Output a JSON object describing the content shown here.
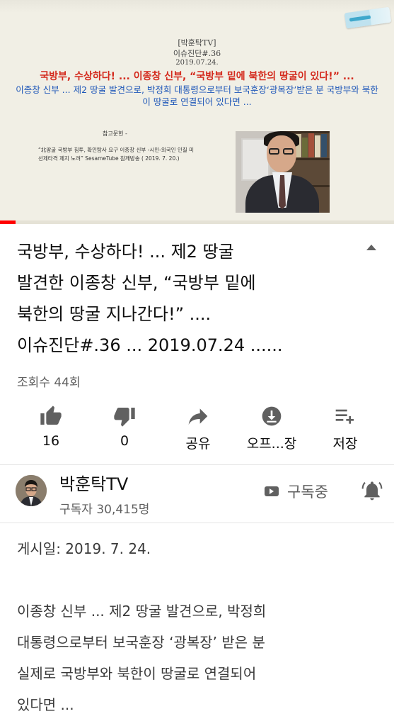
{
  "video": {
    "slide_channel": "[박훈탁TV]",
    "slide_series": "이슈진단#.36",
    "slide_date": "2019.07.24.",
    "slide_headline": "국방부, 수상하다! ... 이종창 신부, “국방부 밑에 북한의 땅굴이 있다!” ...",
    "slide_subtitle": "이종창 신부 ... 제2 땅굴 발견으로, 박정희 대통령으로부터 보국훈장‘광복장’받은 분 국방부와 북한이 땅굴로 연결되어 있다면 ...",
    "slide_reference_heading": "참고문헌 -",
    "slide_reference_body": "“北땅굴 국방부 침투, 확인탐사 요구 이종창 신부 -시민-외국인 인질 미 선제타격 제지 노려” SesameTube 참깨방송 ( 2019. 7. 20.)",
    "progress_percent": 4,
    "colors": {
      "progress": "#ff0000",
      "headline": "#d42b1e",
      "subtitle": "#1d56b8"
    }
  },
  "title": {
    "line1": "국방부, 수상하다! ... 제2 땅굴",
    "line2": "발견한 이종창 신부, “국방부 밑에",
    "line3": "북한의 땅굴 지나간다!” ....",
    "line4": "이슈진단#.36 ... 2019.07.24 ......"
  },
  "views": "조회수 44회",
  "actions": [
    {
      "icon": "thumbs-up-icon",
      "label": "16"
    },
    {
      "icon": "thumbs-down-icon",
      "label": "0"
    },
    {
      "icon": "share-icon",
      "label": "공유"
    },
    {
      "icon": "download-icon",
      "label": "오프...장"
    },
    {
      "icon": "save-playlist-icon",
      "label": "저장"
    }
  ],
  "channel": {
    "name": "박훈탁TV",
    "subscribers": "구독자 30,415명",
    "subscribe_label": "구독중",
    "bell_icon": "bell-icon"
  },
  "description": {
    "published": "게시일: 2019. 7. 24.",
    "line1": "이종창 신부 ... 제2 땅굴 발견으로, 박정희",
    "line2": "대통령으로부터 보국훈장 ‘광복장’ 받은 분",
    "line3": "실제로 국방부와 북한이 땅굴로 연결되어",
    "line4": "있다면 ..."
  }
}
